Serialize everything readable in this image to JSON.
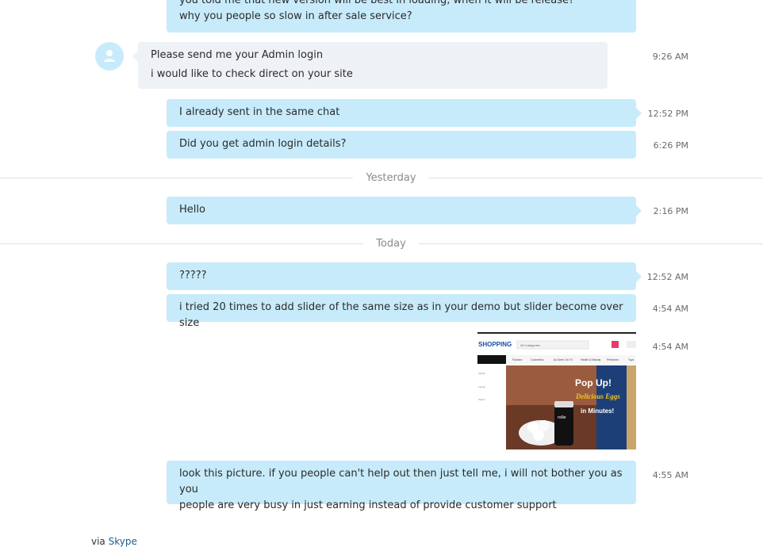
{
  "messages": {
    "m0": {
      "line1": "you told me that new version will be best in loading, when it will be release?",
      "line2": "why you people so slow in after sale service?"
    },
    "m1": {
      "line1": "Please send me your Admin login",
      "line2": "i would like to check direct on your site",
      "time": "9:26 AM"
    },
    "m2": {
      "text": "I already sent in the same chat",
      "time": "12:52 PM"
    },
    "m3": {
      "text": "Did you get admin login details?",
      "time": "6:26 PM"
    },
    "m4": {
      "text": "Hello",
      "time": "2:16 PM"
    },
    "m5": {
      "text": "?????",
      "time": "12:52 AM"
    },
    "m6": {
      "text": "i tried 20 times to add slider of the same size as in your demo but slider become over size",
      "time": "4:54 AM"
    },
    "m7": {
      "time": "4:54 AM"
    },
    "m8": {
      "line1": "look this picture. if you people can't help out then just tell me, i will not bother you as you",
      "line2": "people are very busy in just earning instead of provide customer support",
      "time": "4:55 AM"
    }
  },
  "separators": {
    "yesterday": "Yesterday",
    "today": "Today"
  },
  "attachment": {
    "logo": "SHOPPING",
    "category": "All Categories",
    "nav": [
      "Fashion",
      "Cosmetics",
      "As Seen On TV",
      "Health & Beauty",
      "Perfumes",
      "Toys"
    ],
    "side": [
      "Mobile",
      "Laptop",
      "Watch"
    ],
    "banner_line1": "Pop Up!",
    "banner_line2": "Delicious Eggs",
    "banner_line3": "in Minutes!",
    "product_label": "rollie"
  },
  "footer": {
    "via": "via",
    "app": "Skype"
  },
  "icons": {
    "avatar": "user-icon"
  },
  "colors": {
    "outgoing": "#c7ebfa",
    "incoming": "#eef1f5",
    "link": "#1f5d8c"
  }
}
